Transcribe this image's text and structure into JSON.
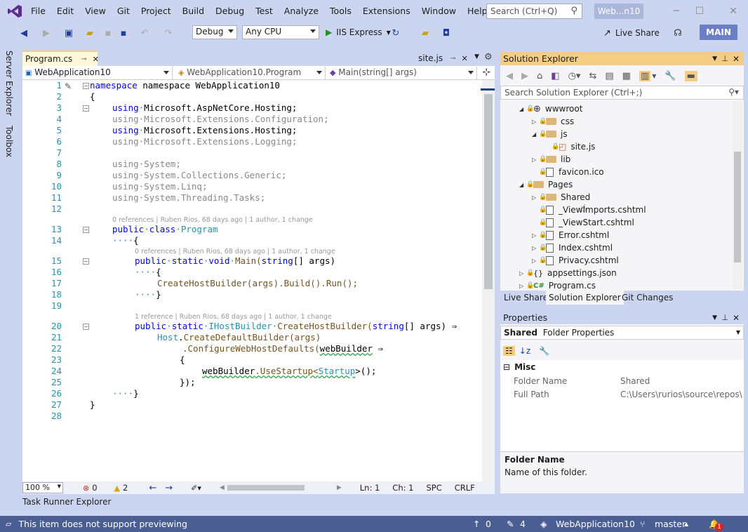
{
  "menu": [
    "File",
    "Edit",
    "View",
    "Git",
    "Project",
    "Build",
    "Debug",
    "Test",
    "Analyze",
    "Tools",
    "Extensions",
    "Window",
    "Help"
  ],
  "title_search": {
    "placeholder": "Search (Ctrl+Q)"
  },
  "solution_badge": "Web...n10",
  "toolbar": {
    "config": "Debug",
    "platform": "Any CPU",
    "run_target": "IIS Express",
    "live_share": "Live Share",
    "branch_badge": "MAIN"
  },
  "side_tabs": [
    "Server Explorer",
    "Toolbox"
  ],
  "doc_tabs": {
    "active": "Program.cs",
    "other": "site.js"
  },
  "navbar": {
    "project": "WebApplication10",
    "class": "WebApplication10.Program",
    "member": "Main(string[] args)"
  },
  "code_lines": [
    {
      "n": "1"
    },
    {
      "n": "2"
    },
    {
      "n": "3"
    },
    {
      "n": "4"
    },
    {
      "n": "5"
    },
    {
      "n": "6"
    },
    {
      "n": "7"
    },
    {
      "n": "8"
    },
    {
      "n": "9"
    },
    {
      "n": "10"
    },
    {
      "n": "11"
    },
    {
      "n": "12"
    },
    {
      "n": "13"
    },
    {
      "n": "14"
    },
    {
      "n": "15"
    },
    {
      "n": "16"
    },
    {
      "n": "17"
    },
    {
      "n": "18"
    },
    {
      "n": "19"
    },
    {
      "n": "20"
    },
    {
      "n": "21"
    },
    {
      "n": "22"
    },
    {
      "n": "23"
    },
    {
      "n": "24"
    },
    {
      "n": "25"
    },
    {
      "n": "26"
    },
    {
      "n": "27"
    },
    {
      "n": "28"
    }
  ],
  "code": {
    "l1": "namespace WebApplication10",
    "l3": "Microsoft.AspNetCore.Hosting;",
    "l4": "Microsoft.Extensions.Configuration;",
    "l5": "Microsoft.Extensions.Hosting;",
    "l6": "Microsoft.Extensions.Logging;",
    "l8": "System;",
    "l9": "System.Collections.Generic;",
    "l10": "System.Linq;",
    "l11": "System.Threading.Tasks;",
    "l13": "Program",
    "l15": "Main(",
    "l15b": "[] args)",
    "l17": "CreateHostBuilder(args).Build().Run();",
    "l20": "CreateHostBuilder(",
    "l20b": "[] args) ⇒",
    "l21": "CreateDefaultBuilder(args)",
    "l22": ".ConfigureWebHostDefaults(",
    "l22b": "webBuilder",
    "l24a": "webBuilder",
    "l24b": ".UseStartup<",
    "l24c": "Startup",
    "l24d": ">();",
    "l25": "});"
  },
  "codelens": {
    "program": "0 references | Ruben Rios, 68 days ago | 1 author, 1 change",
    "main": "0 references | Ruben Rios, 68 days ago | 1 author, 1 change",
    "create": "1 reference | Ruben Rios, 68 days ago | 1 author, 1 change"
  },
  "editor_status": {
    "zoom": "100 %",
    "errors": "0",
    "warnings": "2",
    "ln": "Ln: 1",
    "ch": "Ch: 1",
    "spc": "SPC",
    "crlf": "CRLF"
  },
  "task_runner": "Task Runner Explorer",
  "status": {
    "message": "This item does not support previewing",
    "up": "0",
    "edits": "4",
    "project": "WebApplication10",
    "branch": "master",
    "notif": "1"
  },
  "solution_explorer": {
    "title": "Solution Explorer",
    "search_placeholder": "Search Solution Explorer (Ctrl+;)",
    "items": [
      {
        "label": "wwwroot"
      },
      {
        "label": "css"
      },
      {
        "label": "js"
      },
      {
        "label": "site.js"
      },
      {
        "label": "lib"
      },
      {
        "label": "favicon.ico"
      },
      {
        "label": "Pages"
      },
      {
        "label": "Shared"
      },
      {
        "label": "_ViewImports.cshtml"
      },
      {
        "label": "_ViewStart.cshtml"
      },
      {
        "label": "Error.cshtml"
      },
      {
        "label": "Index.cshtml"
      },
      {
        "label": "Privacy.cshtml"
      },
      {
        "label": "appsettings.json"
      },
      {
        "label": "Program.cs"
      }
    ],
    "tabs": [
      "Live Share",
      "Solution Explorer",
      "Git Changes"
    ]
  },
  "properties": {
    "title": "Properties",
    "object_name": "Shared",
    "object_type": "Folder Properties",
    "category": "Misc",
    "rows": [
      {
        "name": "Folder Name",
        "value": "Shared"
      },
      {
        "name": "Full Path",
        "value": "C:\\Users\\rurios\\source\\repos\\We"
      }
    ],
    "desc_title": "Folder Name",
    "desc_text": "Name of this folder."
  }
}
